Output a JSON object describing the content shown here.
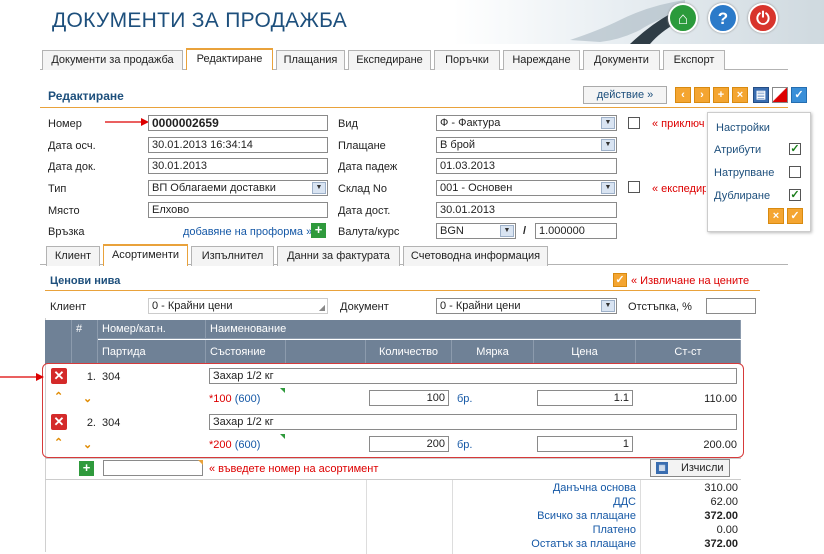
{
  "header": {
    "title": "ДОКУМЕНТИ ЗА ПРОДАЖБА",
    "home": "⌂",
    "help": "?",
    "power": "⏻"
  },
  "tabs": [
    "Документи за продажба",
    "Редактиране",
    "Плащания",
    "Експедиране",
    "Поръчки",
    "Нареждане",
    "Документи",
    "Експорт"
  ],
  "section_title": "Редактиране",
  "action_button": "действие »",
  "form": {
    "number_label": "Номер",
    "number": "0000002659",
    "date_created_label": "Дата осч.",
    "date_created": "30.01.2013 16:34:14",
    "doc_date_label": "Дата док.",
    "doc_date": "30.01.2013",
    "type_label": "Тип",
    "type": "ВП Облагаеми доставки",
    "place_label": "Място",
    "place": "Елхово",
    "link_label": "Връзка",
    "link_text": "добавяне на проформа »",
    "kind_label": "Вид",
    "kind": "Ф - Фактура",
    "payment_label": "Плащане",
    "payment": "В брой",
    "due_label": "Дата падеж",
    "due": "01.03.2013",
    "warehouse_label": "Склад No",
    "warehouse": "001 - Основен",
    "delivery_label": "Дата дост.",
    "delivery": "30.01.2013",
    "currency_label": "Валута/курс",
    "currency": "BGN",
    "slash": "/",
    "rate": "1.000000",
    "close_label": "« приключ",
    "expedite_label": "« експедир"
  },
  "settings": {
    "title": "Настройки",
    "attributes": "Атрибути",
    "accumulation": "Натрупване",
    "duplication": "Дублиране"
  },
  "subtabs": [
    "Клиент",
    "Асортименти",
    "Изпълнител",
    "Данни за фактурата",
    "Счетоводна информация"
  ],
  "price_levels": {
    "title": "Ценови нива",
    "extract": "« Извличане на цените",
    "client_label": "Клиент",
    "client_value": "0 - Крайни цени",
    "doc_label": "Документ",
    "doc_value": "0 - Крайни цени",
    "discount_label": "Отстъпка, %",
    "discount_value": ""
  },
  "table": {
    "headers1": [
      "#",
      "Номер/кат.н.",
      "Наименование"
    ],
    "headers2": [
      "Партида",
      "Състояние",
      "Количество",
      "Мярка",
      "Цена",
      "Ст-ст"
    ],
    "rows": [
      {
        "num": "1.",
        "code": "304",
        "name": "Захар 1/2 кг",
        "state_red": "*100",
        "state_blue": "(600)",
        "qty": "100",
        "unit": "бр.",
        "price": "1.1",
        "value": "110.00"
      },
      {
        "num": "2.",
        "code": "304",
        "name": "Захар 1/2 кг",
        "state_red": "*200",
        "state_blue": "(600)",
        "qty": "200",
        "unit": "бр.",
        "price": "1",
        "value": "200.00"
      }
    ],
    "new_hint": "« въведете номер на асортимент",
    "calc": "Изчисли"
  },
  "totals": {
    "tax_base_label": "Данъчна основа",
    "tax_base": "310.00",
    "vat_label": "ДДС",
    "vat": "62.00",
    "total_label": "Всичко за плащане",
    "total": "372.00",
    "paid_label": "Платено",
    "paid": "0.00",
    "remaining_label": "Остатък за плащане",
    "remaining": "372.00"
  },
  "colors": {
    "accent": "#e9a23b",
    "title": "#1d4f7c",
    "header_table": "#6f8196",
    "link": "#1558a6",
    "highlight": "#d00000"
  }
}
